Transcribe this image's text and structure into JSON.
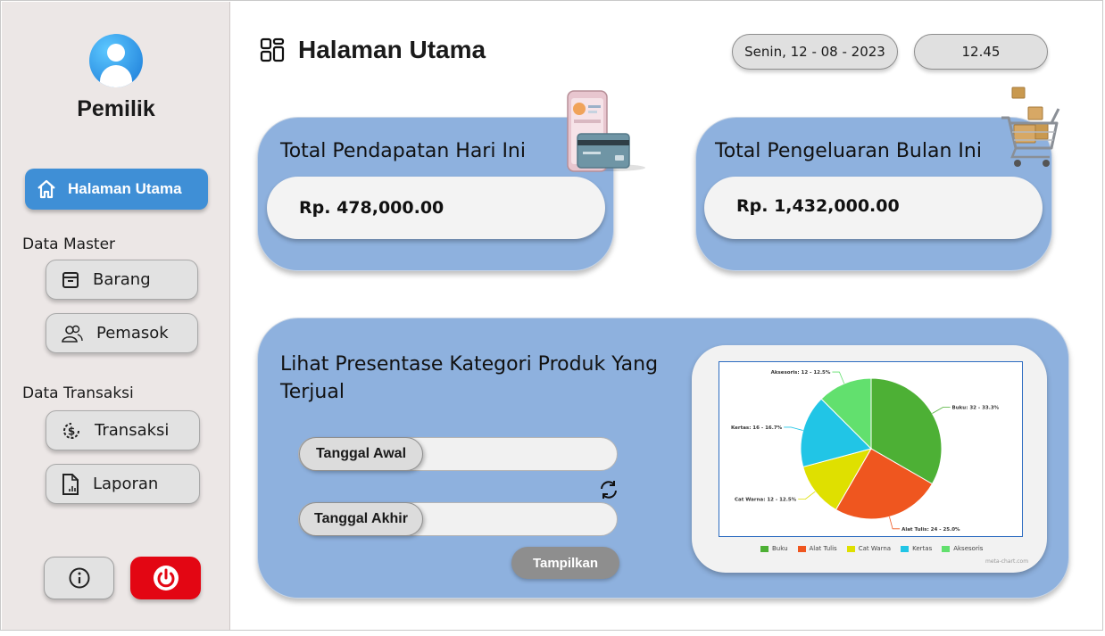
{
  "sidebar": {
    "role": "Pemilik",
    "active_item": "Halaman Utama",
    "sections": [
      {
        "label": "Data Master",
        "items": [
          "Barang",
          "Pemasok"
        ]
      },
      {
        "label": "Data Transaksi",
        "items": [
          "Transaksi",
          "Laporan"
        ]
      }
    ],
    "colors": {
      "active": "#3f8fd6",
      "power": "#e30613"
    }
  },
  "header": {
    "title": "Halaman Utama",
    "date": "Senin, 12 - 08 - 2023",
    "time": "12.45"
  },
  "cards": {
    "income": {
      "title": "Total Pendapatan Hari Ini",
      "value": "Rp. 478,000.00"
    },
    "expense": {
      "title": "Total Pengeluaran Bulan Ini",
      "value": "Rp. 1,432,000.00"
    }
  },
  "report": {
    "title_line1": "Lihat Presentase Kategori Produk Yang",
    "title_line2": "Terjual",
    "start_label": "Tanggal Awal",
    "end_label": "Tanggal Akhir",
    "show_button": "Tampilkan"
  },
  "chart_data": {
    "type": "pie",
    "categories": [
      "Buku",
      "Alat Tulis",
      "Cat Warna",
      "Kertas",
      "Aksesoris"
    ],
    "values": [
      32,
      24,
      12,
      16,
      12
    ],
    "percents": [
      33.3,
      25.0,
      12.5,
      16.7,
      12.5
    ],
    "colors": [
      "#4db035",
      "#ef561f",
      "#dfe000",
      "#21c5e6",
      "#62e06e"
    ],
    "labels": [
      "Buku: 32 - 33.3%",
      "Alat Tulis: 24 - 25.0%",
      "Cat Warna: 12 - 12.5%",
      "Kertas: 16 - 16.7%",
      "Aksesoris: 12 - 12.5%"
    ],
    "legend": "bottom",
    "credit": "meta-chart.com"
  }
}
